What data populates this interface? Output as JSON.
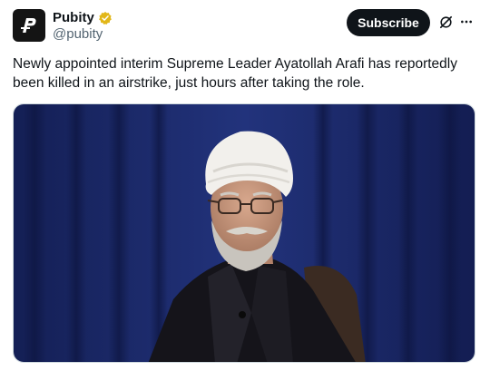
{
  "author": {
    "display_name": "Pubity",
    "handle": "@pubity",
    "avatar_icon": "pubity-logo-icon",
    "verified_badge_color": "#e2b719"
  },
  "actions": {
    "subscribe_label": "Subscribe",
    "grok_icon": "grok-icon",
    "more_icon": "more-icon"
  },
  "tweet": {
    "text": "Newly appointed interim Supreme Leader Ayatollah Arafi has reportedly been killed in an airstrike, just hours after taking the role."
  },
  "colors": {
    "text_primary": "#0f1419",
    "text_secondary": "#536471",
    "subscribe_bg": "#0f1419",
    "curtain": "#1b2a6b"
  }
}
